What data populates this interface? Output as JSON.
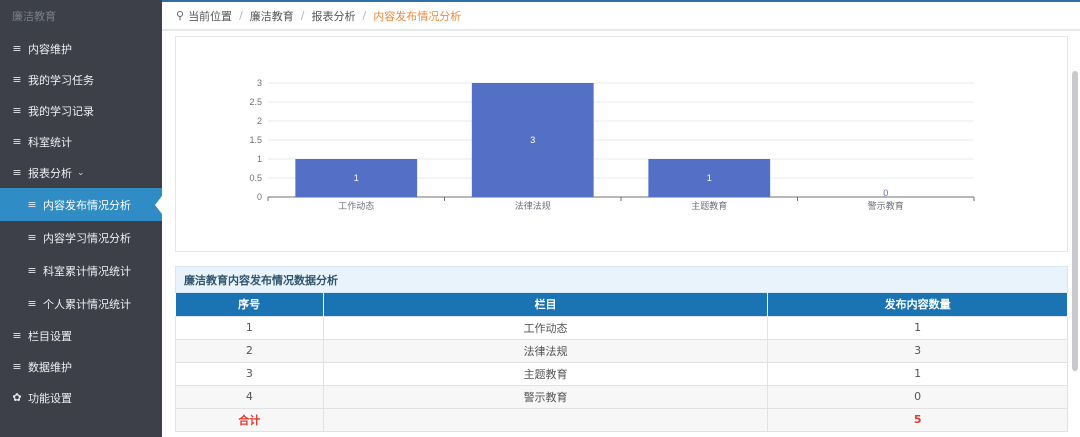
{
  "sidebar": {
    "title": "廉洁教育",
    "items": [
      {
        "label": "内容维护",
        "icon": "menu-icon"
      },
      {
        "label": "我的学习任务",
        "icon": "menu-icon"
      },
      {
        "label": "我的学习记录",
        "icon": "menu-icon"
      },
      {
        "label": "科室统计",
        "icon": "menu-icon"
      },
      {
        "label": "报表分析",
        "icon": "menu-icon",
        "expanded": true
      },
      {
        "label": "内容发布情况分析",
        "icon": "menu-icon",
        "active": true,
        "sub": true
      },
      {
        "label": "内容学习情况分析",
        "icon": "menu-icon",
        "sub": true
      },
      {
        "label": "科室累计情况统计",
        "icon": "menu-icon",
        "sub": true
      },
      {
        "label": "个人累计情况统计",
        "icon": "menu-icon",
        "sub": true
      },
      {
        "label": "栏目设置",
        "icon": "menu-icon"
      },
      {
        "label": "数据维护",
        "icon": "menu-icon"
      },
      {
        "label": "功能设置",
        "icon": "gear-icon"
      }
    ]
  },
  "breadcrumb": {
    "prefix": "当前位置",
    "items": [
      "廉洁教育",
      "报表分析"
    ],
    "current": "内容发布情况分析"
  },
  "chart_data": {
    "type": "bar",
    "categories": [
      "工作动态",
      "法律法规",
      "主题教育",
      "警示教育"
    ],
    "values": [
      1,
      3,
      1,
      0
    ],
    "yticks": [
      "0",
      "0.5",
      "1",
      "1.5",
      "2",
      "2.5",
      "3"
    ],
    "ylim": [
      0,
      3
    ],
    "bar_color": "#5470c6",
    "data_labels": [
      "1",
      "3",
      "1",
      "0"
    ]
  },
  "table": {
    "title": "廉洁教育内容发布情况数据分析",
    "headers": [
      "序号",
      "栏目",
      "发布内容数量"
    ],
    "rows": [
      [
        "1",
        "工作动态",
        "1"
      ],
      [
        "2",
        "法律法规",
        "3"
      ],
      [
        "3",
        "主题教育",
        "1"
      ],
      [
        "4",
        "警示教育",
        "0"
      ]
    ],
    "total_label": "合计",
    "total_value": "5"
  },
  "colors": {
    "sidebar_bg": "#3d4049",
    "active": "#2f8cc4",
    "header_blue": "#1a73b3",
    "accent_orange": "#f08a3c",
    "total_red": "#e23b2e"
  }
}
